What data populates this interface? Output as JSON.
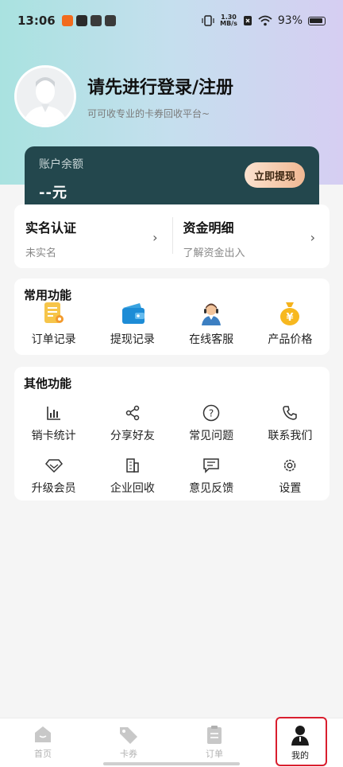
{
  "status_bar": {
    "time": "13:06",
    "net_speed_top": "1.30",
    "net_speed_bottom": "MB/s",
    "battery": "93%"
  },
  "profile": {
    "title": "请先进行登录/注册",
    "subtitle": "可可收专业的卡券回收平台~"
  },
  "balance": {
    "label": "账户余额",
    "amount": "--元",
    "withdraw_label": "立即提现"
  },
  "verify": {
    "left_title": "实名认证",
    "left_sub": "未实名",
    "right_title": "资金明细",
    "right_sub": "了解资金出入"
  },
  "common": {
    "title": "常用功能",
    "items": [
      {
        "label": "订单记录",
        "icon": "order-record-icon"
      },
      {
        "label": "提现记录",
        "icon": "wallet-icon"
      },
      {
        "label": "在线客服",
        "icon": "customer-service-icon"
      },
      {
        "label": "产品价格",
        "icon": "money-bag-icon"
      }
    ]
  },
  "other": {
    "title": "其他功能",
    "items": [
      {
        "label": "销卡统计",
        "icon": "bar-chart-icon"
      },
      {
        "label": "分享好友",
        "icon": "share-icon"
      },
      {
        "label": "常见问题",
        "icon": "question-icon"
      },
      {
        "label": "联系我们",
        "icon": "phone-icon"
      },
      {
        "label": "升级会员",
        "icon": "diamond-icon"
      },
      {
        "label": "企业回收",
        "icon": "building-icon"
      },
      {
        "label": "意见反馈",
        "icon": "feedback-icon"
      },
      {
        "label": "设置",
        "icon": "gear-icon"
      }
    ]
  },
  "tabbar": {
    "tabs": [
      {
        "label": "首页"
      },
      {
        "label": "卡券"
      },
      {
        "label": "订单"
      },
      {
        "label": "我的"
      }
    ]
  },
  "colors": {
    "card_dark": "#23474d",
    "accent_orange": "#f0b893",
    "highlight_red": "#d91e2e"
  }
}
